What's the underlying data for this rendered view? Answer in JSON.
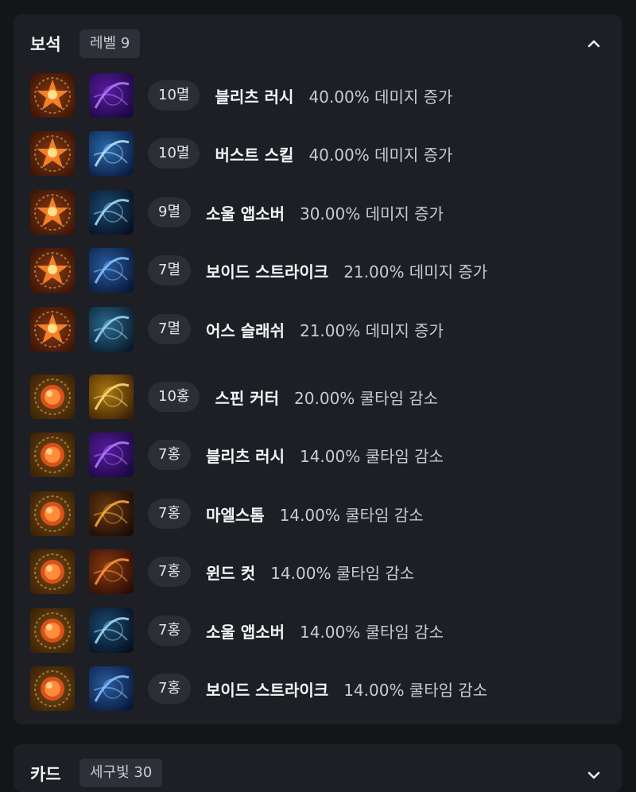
{
  "gems_section": {
    "title": "보석",
    "level_label": "레벨 9",
    "collapse_icon": "chevron-up-icon",
    "rows": [
      {
        "gem": "10멸",
        "gem_type": "damage",
        "gem_icon": "destruction-gem-icon",
        "skill": "블리츠 러시",
        "skill_icon": "blitz-rush-skill-icon",
        "effect": "40.00% 데미지 증가"
      },
      {
        "gem": "10멸",
        "gem_type": "damage",
        "gem_icon": "destruction-gem-icon",
        "skill": "버스트 스킬",
        "skill_icon": "burst-skill-icon",
        "effect": "40.00% 데미지 증가"
      },
      {
        "gem": "9멸",
        "gem_type": "damage",
        "gem_icon": "destruction-gem-icon",
        "skill": "소울 앱소버",
        "skill_icon": "soul-absorber-skill-icon",
        "effect": "30.00% 데미지 증가"
      },
      {
        "gem": "7멸",
        "gem_type": "damage",
        "gem_icon": "destruction-gem-icon",
        "skill": "보이드 스트라이크",
        "skill_icon": "void-strike-skill-icon",
        "effect": "21.00% 데미지 증가"
      },
      {
        "gem": "7멸",
        "gem_type": "damage",
        "gem_icon": "destruction-gem-icon",
        "skill": "어스 슬래쉬",
        "skill_icon": "earth-slash-skill-icon",
        "effect": "21.00% 데미지 증가"
      },
      {
        "gem": "10홍",
        "gem_type": "cooldown",
        "gem_icon": "crimson-gem-icon",
        "skill": "스핀 커터",
        "skill_icon": "spin-cutter-skill-icon",
        "effect": "20.00% 쿨타임 감소"
      },
      {
        "gem": "7홍",
        "gem_type": "cooldown",
        "gem_icon": "crimson-gem-icon",
        "skill": "블리츠 러시",
        "skill_icon": "blitz-rush-skill-icon",
        "effect": "14.00% 쿨타임 감소"
      },
      {
        "gem": "7홍",
        "gem_type": "cooldown",
        "gem_icon": "crimson-gem-icon",
        "skill": "마엘스톰",
        "skill_icon": "maelstrom-skill-icon",
        "effect": "14.00% 쿨타임 감소"
      },
      {
        "gem": "7홍",
        "gem_type": "cooldown",
        "gem_icon": "crimson-gem-icon",
        "skill": "윈드 컷",
        "skill_icon": "wind-cut-skill-icon",
        "effect": "14.00% 쿨타임 감소"
      },
      {
        "gem": "7홍",
        "gem_type": "cooldown",
        "gem_icon": "crimson-gem-icon",
        "skill": "소울 앱소버",
        "skill_icon": "soul-absorber-skill-icon",
        "effect": "14.00% 쿨타임 감소"
      },
      {
        "gem": "7홍",
        "gem_type": "cooldown",
        "gem_icon": "crimson-gem-icon",
        "skill": "보이드 스트라이크",
        "skill_icon": "void-strike-skill-icon",
        "effect": "14.00% 쿨타임 감소"
      }
    ]
  },
  "cards_section": {
    "title": "카드",
    "badge": "세구빛 30",
    "toggle_icon": "chevron-down-icon"
  },
  "colors": {
    "background": "#141519",
    "panel": "#1d1f25",
    "pill": "#2b2e35",
    "text_primary": "#f4f5f7",
    "text_secondary": "#c9cbd1"
  }
}
